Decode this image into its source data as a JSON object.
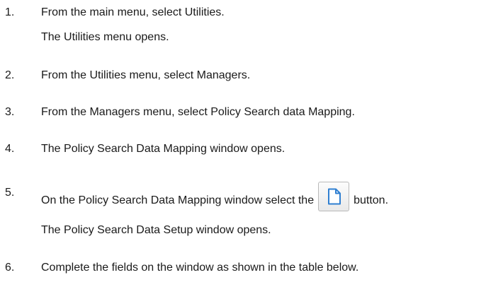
{
  "steps": [
    {
      "number": "1.",
      "text": "From the main menu, select Utilities.",
      "result": "The Utilities menu opens."
    },
    {
      "number": "2.",
      "text": "From the Utilities menu, select Managers."
    },
    {
      "number": "3.",
      "text": "From the Managers menu, select Policy Search data Mapping."
    },
    {
      "number": "4.",
      "text": "The Policy Search Data Mapping window opens."
    },
    {
      "number": "5.",
      "text_before": "On the Policy Search Data Mapping window select the",
      "button_icon": "new-document-icon",
      "text_after": "button.",
      "result": "The Policy Search Data Setup window opens."
    },
    {
      "number": "6.",
      "text": "Complete the fields on the window as shown in the table below."
    }
  ],
  "colors": {
    "text": "#1a1a1a",
    "icon_blue": "#2f7fd1"
  }
}
